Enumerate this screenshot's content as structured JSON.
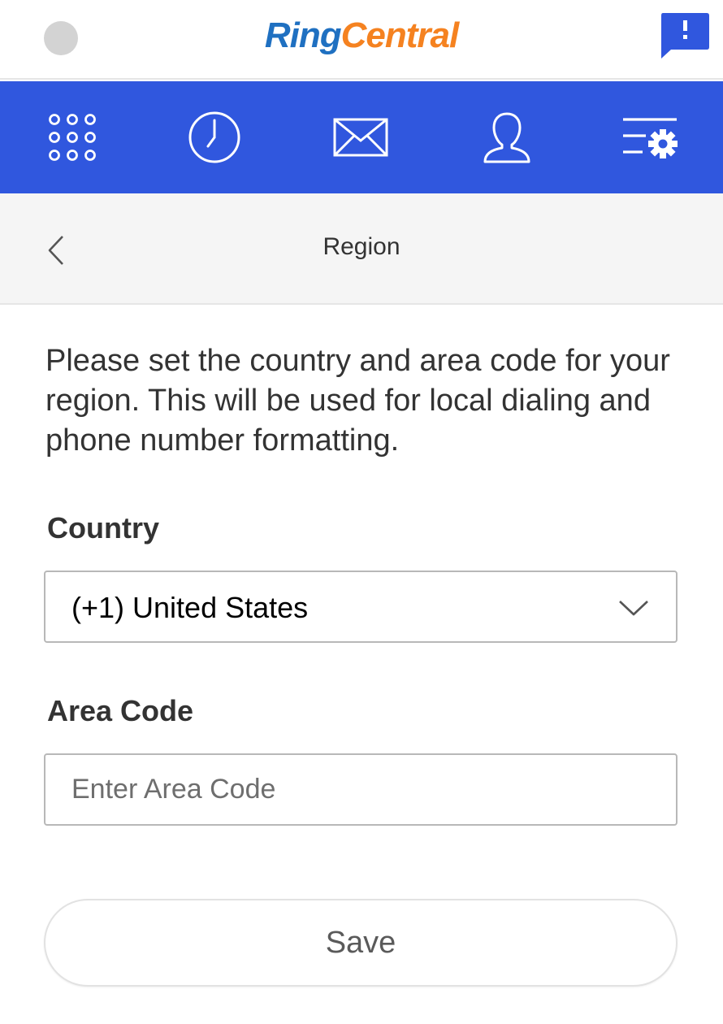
{
  "app": {
    "logo_part1": "Ring",
    "logo_part2": "Central",
    "brand_blue": "#1f70c1",
    "brand_orange": "#f58220"
  },
  "nav": {
    "background": "#3057de",
    "items": [
      {
        "icon": "dialpad-icon"
      },
      {
        "icon": "history-clock-icon"
      },
      {
        "icon": "messages-envelope-icon"
      },
      {
        "icon": "contacts-person-icon"
      },
      {
        "icon": "settings-icon"
      }
    ]
  },
  "header": {
    "title": "Region",
    "back_icon": "chevron-left-icon"
  },
  "form": {
    "description": "Please set the country and area code for your region. This will be used for local dialing and phone number formatting.",
    "country_label": "Country",
    "country_value": "(+1) United States",
    "area_code_label": "Area Code",
    "area_code_placeholder": "Enter Area Code",
    "area_code_value": "",
    "save_label": "Save"
  }
}
